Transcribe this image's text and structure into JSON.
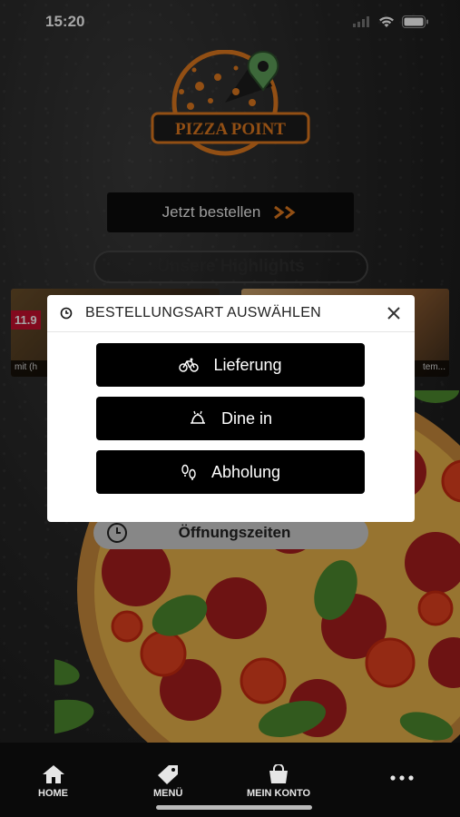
{
  "status_bar": {
    "time": "15:20"
  },
  "brand": {
    "name": "PIZZA POINT",
    "accent": "#e07a1f"
  },
  "order_button": {
    "label": "Jetzt bestellen",
    "icon": "double-chevron-right-icon"
  },
  "highlights": {
    "title": "Unsere Highlights",
    "cards": [
      {
        "price": "11.9",
        "caption": "mit (h"
      },
      {
        "caption": "tem..."
      }
    ]
  },
  "hours_button": {
    "label": "Öffnungszeiten",
    "icon": "clock-icon"
  },
  "modal": {
    "title": "BESTELLUNGSART AUSWÄHLEN",
    "options": [
      {
        "label": "Lieferung",
        "icon": "bicycle-icon"
      },
      {
        "label": "Dine in",
        "icon": "dining-icon"
      },
      {
        "label": "Abholung",
        "icon": "footsteps-icon"
      }
    ]
  },
  "bottom_nav": {
    "items": [
      {
        "label": "HOME",
        "icon": "home-icon"
      },
      {
        "label": "MENÜ",
        "icon": "tag-icon"
      },
      {
        "label": "MEIN KONTO",
        "icon": "shopping-bag-icon"
      },
      {
        "label": "",
        "icon": "more-dots-icon"
      }
    ]
  }
}
